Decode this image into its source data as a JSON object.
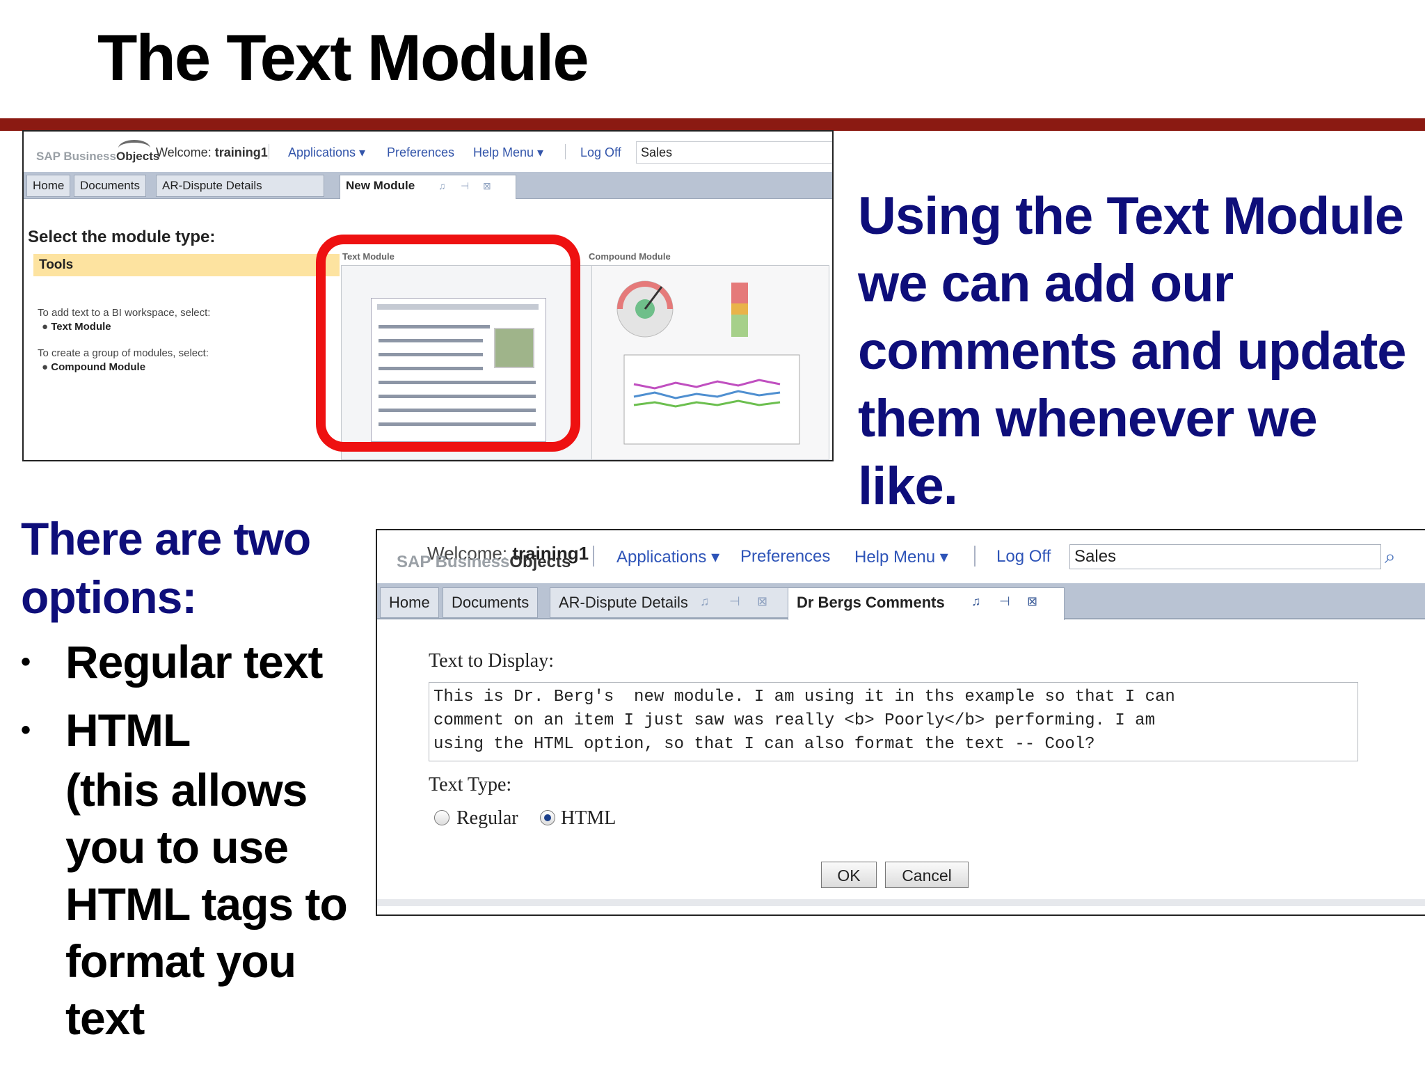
{
  "slide": {
    "title": "The Text Module",
    "right_caption": "Using the Text Module we can add our comments and update them whenever we like.",
    "intro": "There are two options:",
    "bullets": [
      "Regular text",
      "HTML"
    ],
    "html_detail": "(this allows you to use HTML tags to format you text",
    "bullet_glyph": "•",
    "accent_color": "#8b1a12",
    "caption_color": "#0e0e7a"
  },
  "shot1": {
    "logo_sap": "SAP Business",
    "logo_objects": "Objects",
    "welcome_prefix": "Welcome:",
    "welcome_user": "training1",
    "nav": [
      "Applications ▾",
      "Preferences",
      "Help Menu ▾",
      "Log Off"
    ],
    "search_value": "Sales",
    "tabs": [
      "Home",
      "Documents",
      "AR-Dispute Details",
      "New Module"
    ],
    "heading": "Select the module type:",
    "tools": "Tools",
    "hint1": "To add text to a BI workspace, select:",
    "hint1_item": "Text Module",
    "hint2": "To create a group of modules, select:",
    "hint2_item": "Compound Module",
    "text_module_label": "Text Module",
    "compound_module_label": "Compound Module"
  },
  "shot2": {
    "logo_sap": "SAP Business",
    "logo_objects": "Objects",
    "welcome_prefix": "Welcome:",
    "welcome_user": "training1",
    "nav": [
      "Applications ▾",
      "Preferences",
      "Help Menu ▾",
      "Log Off"
    ],
    "search_value": "Sales",
    "tabs": [
      "Home",
      "Documents",
      "AR-Dispute Details",
      "Dr Bergs Comments"
    ],
    "text_label": "Text to Display:",
    "text_value": "This is Dr. Berg's  new module. I am using it in ths example so that I can\ncomment on an item I just saw was really <b> Poorly</b> performing. I am\nusing the HTML option, so that I can also format the text -- Cool?",
    "type_label": "Text Type:",
    "options": [
      "Regular",
      "HTML"
    ],
    "selected_option": "HTML",
    "ok_label": "OK",
    "cancel_label": "Cancel"
  }
}
